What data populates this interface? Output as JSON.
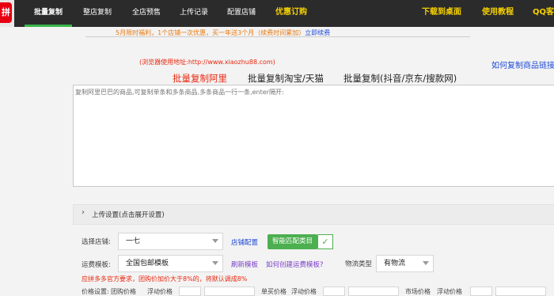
{
  "logo": {
    "glyph": "拼"
  },
  "nav": {
    "items": [
      {
        "label": "批量复制",
        "active": true
      },
      {
        "label": "整店复制"
      },
      {
        "label": "全店预售"
      },
      {
        "label": "上传记录"
      },
      {
        "label": "配置店铺"
      },
      {
        "label": "优惠订购",
        "highlight": true
      }
    ],
    "right": [
      {
        "label": "下载到桌面"
      },
      {
        "label": "使用教程"
      },
      {
        "label": "QQ客服"
      }
    ],
    "highlight_color": "#f5d000",
    "active_underline_color": "#3bb54a"
  },
  "promo": {
    "text": "5月限时福利，1个店铺一次优惠，买一年送3个月（续费时间累加）",
    "link": "立即续费"
  },
  "site_url": "(浏览器使用地址:http://www.xiaozhu88.com)",
  "help_link": "如何复制商品链接",
  "tabs": [
    {
      "label": "批量复制阿里",
      "active": true
    },
    {
      "label": "批量复制淘宝/天猫"
    },
    {
      "label": "批量复制(抖音/京东/搜款网)"
    }
  ],
  "textarea": {
    "placeholder": "复制阿里巴巴的商品,可复制单条和多条商品,多条商品一行一条,enter隔开:"
  },
  "settings": {
    "title": "上传设置(点击展开设置)",
    "store_label": "选择店铺:",
    "store_value": "一七",
    "store_config_link": "店铺配置",
    "smart_match_button": "智能匹配类目",
    "shipping_label": "运费模板:",
    "shipping_value": "全国包邮模板",
    "refresh_link": "刷新模板",
    "how_to_link": "如何创建运费模板?",
    "logistics_label": "物流类型",
    "logistics_value": "有物流",
    "warning": "应拼多多官方要求，团购价加价大于8%的，将默认调成8%",
    "bottom_labels": [
      "价格设置:",
      "团购价格",
      "浮动价格",
      "单买价格",
      "浮动价格",
      "市场价格",
      "浮动价格"
    ]
  },
  "colors": {
    "accent_red": "#e8280f",
    "link_blue": "#1f4bd6",
    "link_purple": "#7a3fc9",
    "green": "#4caf50"
  }
}
